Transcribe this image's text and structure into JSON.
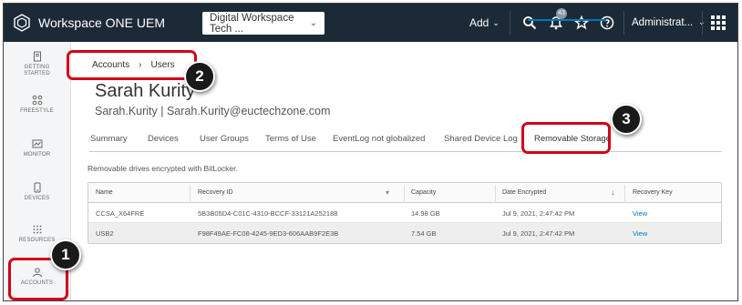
{
  "topbar": {
    "brand": "Workspace ONE UEM",
    "org_select": "Digital Workspace Tech ...",
    "add_label": "Add",
    "notification_count": "43",
    "admin_label": "Administrat..."
  },
  "leftnav": {
    "items": [
      {
        "label_1": "GETTING",
        "label_2": "STARTED",
        "icon": "book-icon"
      },
      {
        "label_1": "FREESTYLE",
        "label_2": "",
        "icon": "freestyle-icon"
      },
      {
        "label_1": "MONITOR",
        "label_2": "",
        "icon": "monitor-icon"
      },
      {
        "label_1": "DEVICES",
        "label_2": "",
        "icon": "devices-icon"
      },
      {
        "label_1": "RESOURCES",
        "label_2": "",
        "icon": "resources-icon"
      },
      {
        "label_1": "ACCOUNTS",
        "label_2": "",
        "icon": "accounts-icon"
      }
    ]
  },
  "breadcrumb": {
    "item1": "Accounts",
    "sep": "›",
    "item2": "Users"
  },
  "user": {
    "name": "Sarah Kurity",
    "subtitle": "Sarah.Kurity | Sarah.Kurity@euctechzone.com"
  },
  "tabs": [
    "Summary",
    "Devices",
    "User Groups",
    "Terms of Use",
    "EventLog not globalized",
    "Shared Device Log",
    "Removable Storage"
  ],
  "description": "Removable drives encrypted with BitLocker.",
  "table": {
    "headers": [
      "Name",
      "Recovery ID",
      "Capacity",
      "Date Encrypted",
      "Recovery Key"
    ],
    "rows": [
      [
        "CCSA_X64FRE",
        "5B3B05D4-C01C-4310-BCCF-33121A252188",
        "14.98 GB",
        "Jul 9, 2021, 2:47:42 PM",
        "View"
      ],
      [
        "USB2",
        "F98F49AE-FC08-4245-9ED3-606AAB9F2E3B",
        "7.54 GB",
        "Jul 9, 2021, 2:47:42 PM",
        "View"
      ]
    ]
  },
  "callouts": [
    "1",
    "2",
    "3"
  ],
  "colors": {
    "topbar": "#1c2a38",
    "accent": "#0079b8",
    "highlight": "#d0021b"
  }
}
